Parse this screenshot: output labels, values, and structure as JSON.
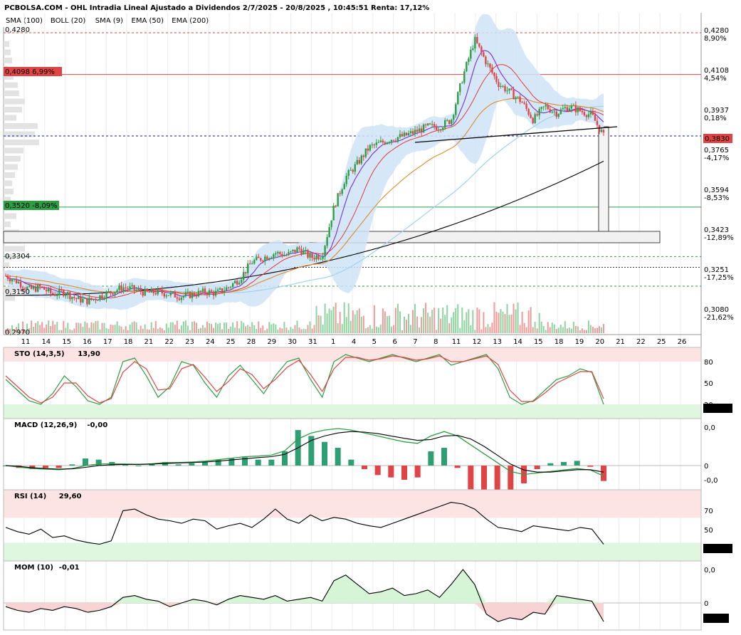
{
  "header": {
    "title": "PCBOLSA.COM - OHL Intradia Lineal Ajustado a Dividendos 2/7/2025 - 20/8/2025 , 10:45:51 Renta: 17,12%"
  },
  "legend": [
    {
      "label": "SMA (100)",
      "color": "#9fd3f0"
    },
    {
      "label": "BOLL (20)",
      "color": "#e03a3a"
    },
    {
      "label": "SMA (9)",
      "color": "#7a2fd0"
    },
    {
      "label": "EMA (50)",
      "color": "#e08a2a"
    },
    {
      "label": "EMA (200)",
      "color": "#000000"
    }
  ],
  "colors": {
    "up": "#2e9e45",
    "down": "#e04444",
    "boll_fill": "#cfe3f7",
    "resistance": "#e04444",
    "support": "#2e9e45"
  },
  "chart_data": [
    {
      "type": "candlestick",
      "title": "PCBOLSA.COM - OHL Intradia Lineal Ajustado a Dividendos 2/7/2025 - 20/8/2025 , 10:45:51 Renta: 17,12%",
      "x_ticks": [
        "11",
        "14",
        "15",
        "16",
        "17",
        "18",
        "21",
        "22",
        "23",
        "24",
        "25",
        "28",
        "29",
        "30",
        "31",
        "1",
        "4",
        "5",
        "6",
        "7",
        "8",
        "11",
        "12",
        "13",
        "14",
        "15",
        "18",
        "19",
        "20",
        "21",
        "22",
        "25",
        "26"
      ],
      "right_ticks": [
        {
          "value": "0,4280",
          "pct": "8,90%",
          "pct_color": "#2e9e45"
        },
        {
          "value": "0,4108",
          "pct": "4,54%",
          "pct_color": "#2e9e45"
        },
        {
          "value": "0,3937",
          "pct": "0,18%",
          "pct_color": "#2e9e45"
        },
        {
          "value": "0,3765",
          "pct": "-4,17%",
          "pct_color": "#e04444"
        },
        {
          "value": "0,3594",
          "pct": "-8,53%",
          "pct_color": "#e04444"
        },
        {
          "value": "0,3423",
          "pct": "-12,89%",
          "pct_color": "#e04444"
        },
        {
          "value": "0,3251",
          "pct": "-17,25%",
          "pct_color": "#e04444"
        },
        {
          "value": "0,3080",
          "pct": "-21,62%",
          "pct_color": "#e04444"
        }
      ],
      "current_price": "0,3830",
      "left_labels": [
        {
          "text": "0,4280",
          "style": "plain"
        },
        {
          "text": "0,4098  6,99%",
          "style": "red"
        },
        {
          "text": "0,3520  -8,09%",
          "style": "green"
        },
        {
          "text": "0,3304",
          "style": "plain"
        },
        {
          "text": "0,3150",
          "style": "plain"
        },
        {
          "text": "0,2970",
          "style": "plain"
        }
      ],
      "ylim": [
        0.297,
        0.4305
      ],
      "price_path": [
        0.322,
        0.3195,
        0.316,
        0.317,
        0.314,
        0.315,
        0.312,
        0.311,
        0.313,
        0.315,
        0.317,
        0.316,
        0.3145,
        0.315,
        0.314,
        0.313,
        0.314,
        0.315,
        0.3145,
        0.317,
        0.321,
        0.328,
        0.33,
        0.332,
        0.331,
        0.334,
        0.33,
        0.331,
        0.352,
        0.365,
        0.371,
        0.378,
        0.38,
        0.382,
        0.383,
        0.385,
        0.387,
        0.387,
        0.39,
        0.409,
        0.425,
        0.415,
        0.406,
        0.402,
        0.398,
        0.39,
        0.396,
        0.393,
        0.396,
        0.394,
        0.392,
        0.383
      ]
    },
    {
      "type": "line",
      "title": "STO (14,3,5)",
      "value_label": "13,90",
      "last_value": "13,907",
      "levels": [
        "80",
        "50",
        "20"
      ],
      "series_k": [
        55,
        40,
        25,
        20,
        35,
        60,
        45,
        25,
        20,
        30,
        80,
        85,
        60,
        30,
        45,
        80,
        75,
        50,
        30,
        60,
        75,
        55,
        35,
        60,
        80,
        85,
        55,
        30,
        80,
        90,
        85,
        80,
        85,
        90,
        85,
        80,
        85,
        90,
        75,
        80,
        85,
        90,
        70,
        30,
        20,
        25,
        40,
        55,
        60,
        70,
        65,
        20
      ],
      "series_d": [
        60,
        45,
        30,
        22,
        30,
        50,
        50,
        32,
        22,
        28,
        65,
        80,
        70,
        40,
        42,
        70,
        76,
        58,
        38,
        52,
        70,
        62,
        42,
        55,
        72,
        82,
        62,
        38,
        70,
        86,
        86,
        82,
        84,
        88,
        86,
        82,
        84,
        88,
        80,
        80,
        84,
        88,
        76,
        40,
        24,
        24,
        36,
        50,
        58,
        66,
        66,
        28
      ]
    },
    {
      "type": "line",
      "title": "MACD (12,26,9)",
      "value_label": "-0,00",
      "right_ticks": [
        "0,0",
        "0",
        "-0,0"
      ],
      "series_macd": [
        0.0,
        -0.0005,
        -0.001,
        -0.0012,
        -0.0014,
        -0.001,
        0.0,
        0.0005,
        0.0006,
        0.0005,
        0.0004,
        0.0006,
        0.001,
        0.001,
        0.0012,
        0.0015,
        0.002,
        0.0025,
        0.003,
        0.0032,
        0.0035,
        0.005,
        0.009,
        0.011,
        0.012,
        0.0125,
        0.012,
        0.011,
        0.01,
        0.009,
        0.008,
        0.0075,
        0.01,
        0.0115,
        0.01,
        0.007,
        0.004,
        0.001,
        -0.002,
        -0.003,
        -0.0025,
        -0.002,
        -0.0015,
        -0.001,
        -0.0015,
        -0.0035
      ],
      "series_signal": [
        0.0,
        -0.0003,
        -0.0007,
        -0.001,
        -0.0012,
        -0.0011,
        -0.0006,
        0.0,
        0.0003,
        0.0004,
        0.0004,
        0.0005,
        0.0007,
        0.0009,
        0.001,
        0.0012,
        0.0015,
        0.0019,
        0.0023,
        0.0027,
        0.003,
        0.0038,
        0.006,
        0.0085,
        0.01,
        0.011,
        0.0115,
        0.0113,
        0.0108,
        0.01,
        0.0092,
        0.0085,
        0.0088,
        0.01,
        0.0102,
        0.009,
        0.0065,
        0.0035,
        0.0005,
        -0.0015,
        -0.0022,
        -0.0022,
        -0.0018,
        -0.0014,
        -0.0014,
        -0.0022
      ]
    },
    {
      "type": "line",
      "title": "RSI (14)",
      "value_label": "29,60",
      "last_value": "29,600",
      "levels": [
        "70",
        "50",
        "30"
      ],
      "series": [
        50,
        45,
        42,
        48,
        38,
        40,
        35,
        32,
        30,
        34,
        70,
        72,
        65,
        60,
        58,
        55,
        60,
        58,
        48,
        52,
        55,
        50,
        60,
        72,
        60,
        55,
        65,
        58,
        62,
        60,
        55,
        52,
        50,
        55,
        60,
        65,
        70,
        75,
        80,
        78,
        72,
        60,
        50,
        48,
        45,
        52,
        50,
        48,
        46,
        50,
        48,
        30
      ]
    },
    {
      "type": "area",
      "title": "MOM (10)",
      "value_label": "-0,01",
      "last_value": "-0,015",
      "right_ticks": [
        "0,0",
        "0"
      ],
      "series": [
        -0.002,
        -0.004,
        -0.005,
        -0.003,
        -0.004,
        -0.002,
        -0.003,
        -0.005,
        -0.004,
        -0.002,
        0.003,
        0.004,
        0.002,
        0.001,
        -0.002,
        0.0,
        0.002,
        0.001,
        -0.001,
        0.002,
        0.004,
        0.003,
        0.002,
        0.004,
        0.001,
        0.002,
        0.003,
        0.001,
        0.012,
        0.015,
        0.01,
        0.005,
        0.006,
        0.008,
        0.004,
        0.005,
        0.007,
        0.003,
        0.01,
        0.018,
        0.01,
        -0.006,
        -0.01,
        -0.008,
        -0.009,
        -0.005,
        -0.006,
        0.004,
        0.003,
        0.002,
        0.001,
        -0.01
      ]
    }
  ]
}
